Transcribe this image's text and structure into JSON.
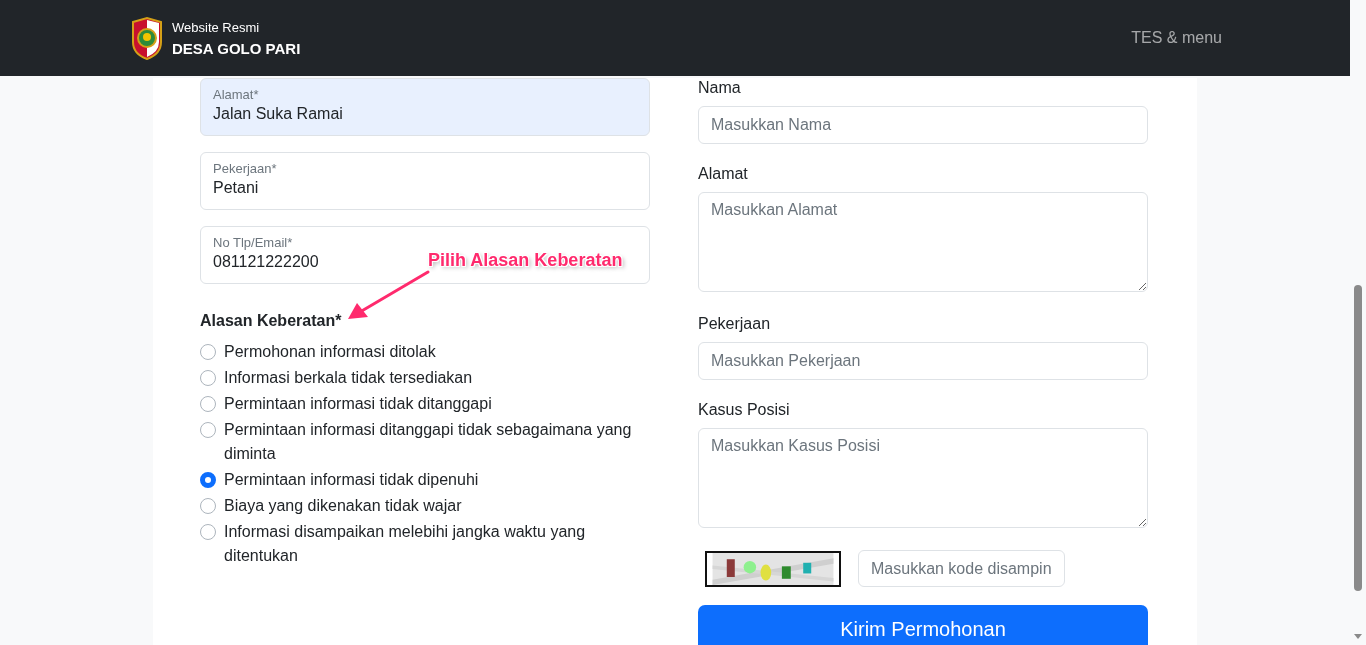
{
  "navbar": {
    "subtitle": "Website Resmi",
    "title": "DESA GOLO PARI",
    "menu": "TES & menu"
  },
  "left_form": {
    "fields": [
      {
        "label": "Alamat*",
        "value": "Jalan Suka Ramai",
        "autofilled": true
      },
      {
        "label": "Pekerjaan*",
        "value": "Petani",
        "autofilled": false
      },
      {
        "label": "No Tlp/Email*",
        "value": "081121222200",
        "autofilled": false
      }
    ],
    "reason_heading": "Alasan Keberatan*",
    "reasons": [
      {
        "label": "Permohonan informasi ditolak",
        "selected": false
      },
      {
        "label": "Informasi berkala tidak tersediakan",
        "selected": false
      },
      {
        "label": "Permintaan informasi tidak ditanggapi",
        "selected": false
      },
      {
        "label": "Permintaan informasi ditanggapi tidak sebagaimana yang diminta",
        "selected": false
      },
      {
        "label": "Permintaan informasi tidak dipenuhi",
        "selected": true
      },
      {
        "label": "Biaya yang dikenakan tidak wajar",
        "selected": false
      },
      {
        "label": "Informasi disampaikan melebihi jangka waktu yang ditentukan",
        "selected": false
      }
    ],
    "annotation": "Pilih Alasan Keberatan"
  },
  "right_form": {
    "fields": [
      {
        "kind": "input",
        "label": "Nama",
        "placeholder": "Masukkan Nama"
      },
      {
        "kind": "textarea",
        "label": "Alamat",
        "placeholder": "Masukkan Alamat"
      },
      {
        "kind": "input",
        "label": "Pekerjaan",
        "placeholder": "Masukkan Pekerjaan"
      },
      {
        "kind": "textarea",
        "label": "Kasus Posisi",
        "placeholder": "Masukkan Kasus Posisi"
      }
    ],
    "captcha": {
      "kind": "picture",
      "placeholder": "Masukkan kode disampin"
    },
    "submit": "Kirim Permohonan"
  }
}
